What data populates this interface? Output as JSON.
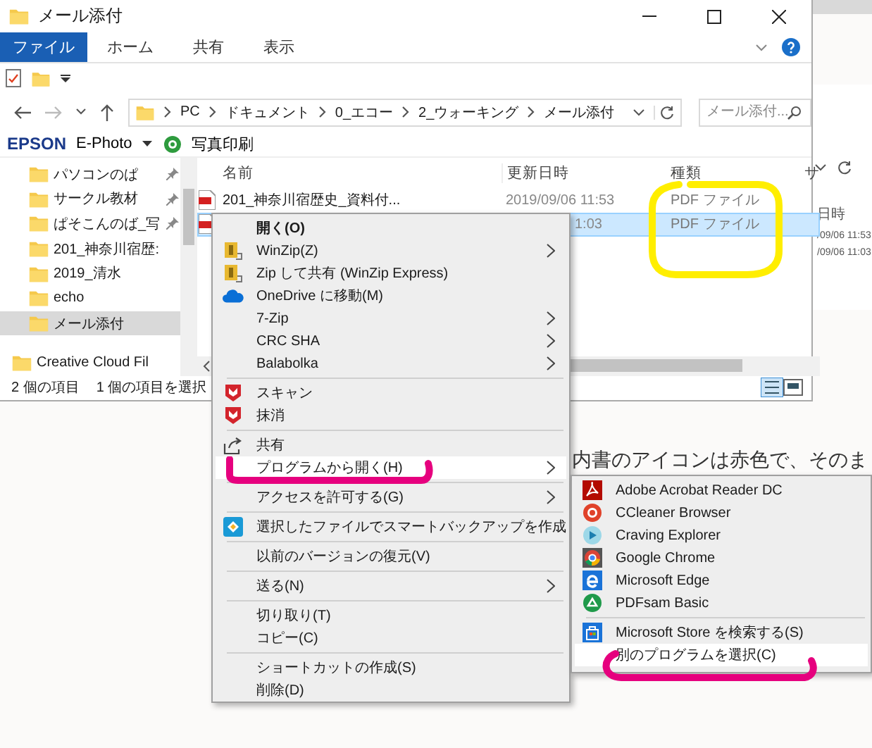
{
  "window": {
    "title": "メール添付"
  },
  "ribbon_tabs": [
    {
      "label": "ファイル",
      "selected": true
    },
    {
      "label": "ホーム",
      "selected": false
    },
    {
      "label": "共有",
      "selected": false
    },
    {
      "label": "表示",
      "selected": false
    }
  ],
  "address_bar": {
    "path": [
      "PC",
      "ドキュメント",
      "0_エコー",
      "2_ウォーキング",
      "メール添付"
    ]
  },
  "search": {
    "placeholder": "メール添付..."
  },
  "epson_toolbar": {
    "brand": "EPSON",
    "app": "E-Photo",
    "action": "写真印刷"
  },
  "nav_pane": {
    "quick_access": [
      {
        "label": "パソコンのぱ",
        "pinned": true,
        "selected": false
      },
      {
        "label": "サークル教材",
        "pinned": true,
        "selected": false
      },
      {
        "label": "ぱそこんのば_写",
        "pinned": true,
        "selected": false
      },
      {
        "label": "201_神奈川宿歴:",
        "pinned": false,
        "selected": false
      },
      {
        "label": "2019_清水",
        "pinned": false,
        "selected": false
      },
      {
        "label": "echo",
        "pinned": false,
        "selected": false
      },
      {
        "label": "メール添付",
        "pinned": false,
        "selected": true
      }
    ],
    "items": [
      {
        "label": "Creative Cloud Fil"
      }
    ]
  },
  "file_list": {
    "columns": [
      "名前",
      "更新日時",
      "種類",
      "サ"
    ],
    "rows": [
      {
        "name": "201_神奈川宿歴史_資料付...",
        "modified": "2019/09/06 11:53",
        "type": "PDF ファイル",
        "selected": false
      },
      {
        "modified": "1:03",
        "type": "PDF ファイル",
        "selected": true
      }
    ]
  },
  "status_bar": {
    "count": "2 個の項目",
    "selection": "1 個の項目を選択"
  },
  "context_menu": {
    "items": [
      {
        "kind": "plain",
        "label": "開く(O)",
        "bold": true,
        "submenu": false,
        "highlighted": false
      },
      {
        "kind": "winzip",
        "label": "WinZip(Z)",
        "bold": false,
        "submenu": true,
        "highlighted": false
      },
      {
        "kind": "winzip",
        "label": "Zip して共有 (WinZip Express)",
        "bold": false,
        "submenu": false,
        "highlighted": false
      },
      {
        "kind": "onedrive",
        "label": "OneDrive に移動(M)",
        "bold": false,
        "submenu": false,
        "highlighted": false
      },
      {
        "kind": "plain",
        "label": "7-Zip",
        "bold": false,
        "submenu": true,
        "highlighted": false
      },
      {
        "kind": "plain",
        "label": "CRC SHA",
        "bold": false,
        "submenu": true,
        "highlighted": false
      },
      {
        "kind": "plain",
        "label": "Balabolka",
        "bold": false,
        "submenu": true,
        "highlighted": false
      },
      {
        "kind": "separator"
      },
      {
        "kind": "shield",
        "label": "スキャン",
        "bold": false,
        "submenu": false,
        "highlighted": false
      },
      {
        "kind": "shield",
        "label": "抹消",
        "bold": false,
        "submenu": false,
        "highlighted": false
      },
      {
        "kind": "separator"
      },
      {
        "kind": "share",
        "label": "共有",
        "bold": false,
        "submenu": false,
        "highlighted": false
      },
      {
        "kind": "plain",
        "label": "プログラムから開く(H)",
        "bold": false,
        "submenu": true,
        "highlighted": true
      },
      {
        "kind": "separator"
      },
      {
        "kind": "plain",
        "label": "アクセスを許可する(G)",
        "bold": false,
        "submenu": true,
        "highlighted": false
      },
      {
        "kind": "separator"
      },
      {
        "kind": "backup",
        "label": "選択したファイルでスマートバックアップを作成",
        "bold": false,
        "submenu": false,
        "highlighted": false
      },
      {
        "kind": "separator"
      },
      {
        "kind": "plain",
        "label": "以前のバージョンの復元(V)",
        "bold": false,
        "submenu": false,
        "highlighted": false
      },
      {
        "kind": "separator"
      },
      {
        "kind": "plain",
        "label": "送る(N)",
        "bold": false,
        "submenu": true,
        "highlighted": false
      },
      {
        "kind": "separator"
      },
      {
        "kind": "plain",
        "label": "切り取り(T)",
        "bold": false,
        "submenu": false,
        "highlighted": false
      },
      {
        "kind": "plain",
        "label": "コピー(C)",
        "bold": false,
        "submenu": false,
        "highlighted": false
      },
      {
        "kind": "separator"
      },
      {
        "kind": "plain",
        "label": "ショートカットの作成(S)",
        "bold": false,
        "submenu": false,
        "highlighted": false
      },
      {
        "kind": "plain",
        "label": "削除(D)",
        "bold": false,
        "submenu": false,
        "highlighted": false
      }
    ]
  },
  "submenu": {
    "items": [
      {
        "kind": "acrobat",
        "label": "Adobe Acrobat Reader DC",
        "highlighted": false
      },
      {
        "kind": "ccleaner",
        "label": "CCleaner Browser",
        "highlighted": false
      },
      {
        "kind": "craving",
        "label": "Craving Explorer",
        "highlighted": false
      },
      {
        "kind": "chrome",
        "label": "Google Chrome",
        "highlighted": false
      },
      {
        "kind": "edge",
        "label": "Microsoft Edge",
        "highlighted": false
      },
      {
        "kind": "pdfsam",
        "label": "PDFsam Basic",
        "highlighted": false
      },
      {
        "kind": "separator"
      },
      {
        "kind": "store",
        "label": "Microsoft Store を検索する(S)",
        "highlighted": false
      },
      {
        "kind": "plain",
        "label": "別のプログラムを選択(C)",
        "highlighted": true
      }
    ]
  },
  "background_window": {
    "column": "日時",
    "dates": [
      "/09/06 11:53",
      "/09/06 11:03"
    ]
  },
  "background_page": {
    "text": "内書のアイコンは赤色で、そのま"
  }
}
